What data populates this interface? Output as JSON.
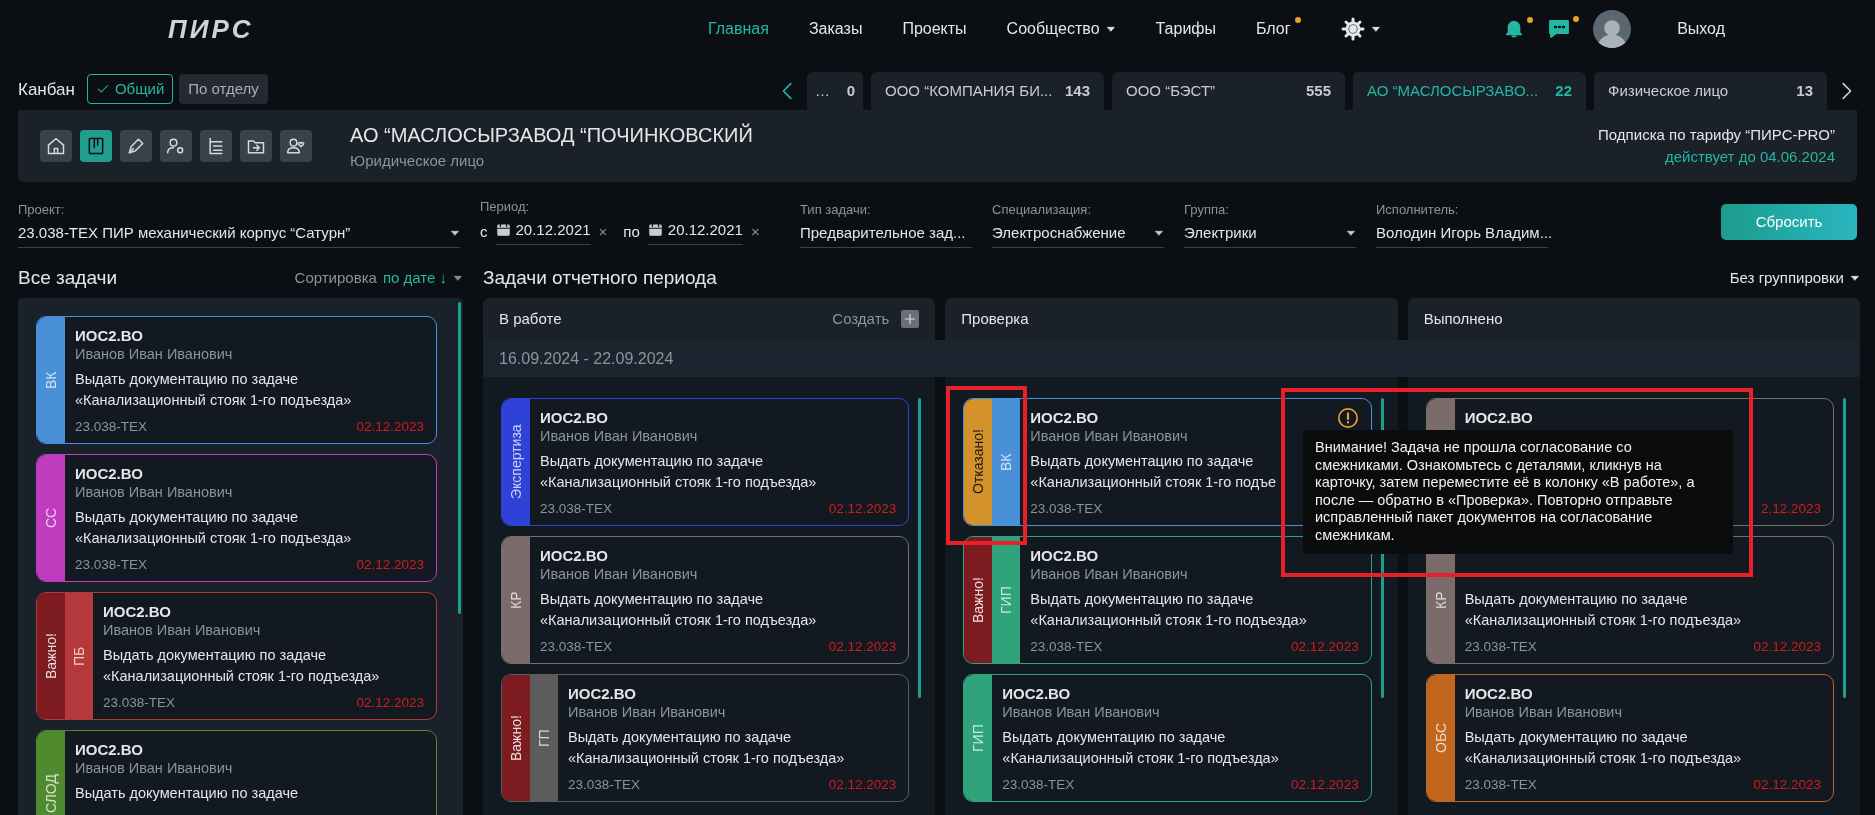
{
  "nav": {
    "logo": "ПИРС",
    "items": [
      {
        "label": "Главная",
        "selected": true,
        "dropdown": false,
        "dot": false
      },
      {
        "label": "Заказы",
        "selected": false,
        "dropdown": false,
        "dot": false
      },
      {
        "label": "Проекты",
        "selected": false,
        "dropdown": false,
        "dot": false
      },
      {
        "label": "Сообщество",
        "selected": false,
        "dropdown": true,
        "dot": false
      },
      {
        "label": "Тарифы",
        "selected": false,
        "dropdown": false,
        "dot": false
      },
      {
        "label": "Блог",
        "selected": false,
        "dropdown": false,
        "dot": true
      }
    ],
    "bell_dot": true,
    "chat_dot": true,
    "logout": "Выход"
  },
  "kanban": {
    "label": "Канбан",
    "scopes": [
      {
        "label": "Общий",
        "selected": true
      },
      {
        "label": "По отделу",
        "selected": false
      }
    ]
  },
  "client_tabs": [
    {
      "name": "…",
      "count": "0",
      "selected": false
    },
    {
      "name": "ООО “КОМПАНИЯ БИ...",
      "count": "143",
      "selected": false
    },
    {
      "name": "ООО “БЭСТ”",
      "count": "555",
      "selected": false
    },
    {
      "name": "АО “МАСЛОСЫРЗАВО...",
      "count": "22",
      "selected": true
    },
    {
      "name": "Физическое лицо",
      "count": "13",
      "selected": false
    }
  ],
  "toolbar": [
    {
      "kind": "home",
      "selected": false
    },
    {
      "kind": "board",
      "selected": true
    },
    {
      "kind": "pen",
      "selected": false
    },
    {
      "kind": "user-gear",
      "selected": false
    },
    {
      "kind": "tree",
      "selected": false
    },
    {
      "kind": "folder",
      "selected": false
    },
    {
      "kind": "user-heart",
      "selected": false
    }
  ],
  "client": {
    "title": "АО “МАСЛОСЫРЗАВОД “ПОЧИНКОВСКИЙ",
    "subtitle": "Юридическое лицо",
    "subscription": "Подписка по тарифу “ПИРС-PRO”",
    "valid_until": "действует до 04.06.2024"
  },
  "filters": [
    {
      "kind": "select",
      "label": "Проект:",
      "value": "23.038-ТЕХ ПИР механический корпус “Сатурн”"
    },
    {
      "kind": "period",
      "label": "Период:",
      "from": {
        "prefix": "с",
        "date": "20.12.2021",
        "clear": "×"
      },
      "to": {
        "prefix": "по",
        "date": "20.12.2021",
        "clear": "×"
      }
    },
    {
      "kind": "select",
      "label": "Тип задачи:",
      "value": "Предварительное зад..."
    },
    {
      "kind": "select",
      "label": "Специализация:",
      "value": "Электроснабжение"
    },
    {
      "kind": "select",
      "label": "Группа:",
      "value": "Электрики"
    },
    {
      "kind": "select",
      "label": "Исполнитель:",
      "value": "Володин Игорь Владим..."
    }
  ],
  "reset_button": "Сбросить",
  "all_tasks": {
    "title": "Все задачи",
    "sort_label": "Сортировка",
    "sort_value": "по дате ↓",
    "cards": [
      {
        "tag": "ВК",
        "color": "#4a90d9",
        "code": "ИОС2.ВО",
        "assignee": "Иванов Иван Иванович",
        "description": [
          "Выдать документацию по задаче",
          "«Канализационный стояк 1-го подъезда»"
        ],
        "project": "23.038-ТЕХ",
        "due": "02.12.2023"
      },
      {
        "tag": "СС",
        "color": "#c03cbf",
        "code": "ИОС2.ВО",
        "assignee": "Иванов Иван Иванович",
        "description": [
          "Выдать документацию по задаче",
          "«Канализационный стояк 1-го подъезда»"
        ],
        "project": "23.038-ТЕХ",
        "due": "02.12.2023"
      },
      {
        "tag": "ПБ",
        "color": "#b5393a",
        "flag": {
          "kind": "important",
          "label": "Важно!"
        },
        "code": "ИОС2.ВО",
        "assignee": "Иванов Иван Иванович",
        "description": [
          "Выдать документацию по задаче",
          "«Канализационный стояк 1-го подъезда»"
        ],
        "project": "23.038-ТЕХ",
        "due": "02.12.2023"
      },
      {
        "tag": "СЛОД",
        "color": "#4f8a2f",
        "code": "ИОС2.ВО",
        "assignee": "Иванов Иван Иванович",
        "description": [
          "Выдать документацию по задаче"
        ]
      }
    ]
  },
  "board": {
    "title": "Задачи отчетного периода",
    "grouping": "Без группировки",
    "period": "16.09.2024 - 22.09.2024",
    "columns": [
      {
        "title": "В работе",
        "create": "Создать",
        "cards": [
          {
            "tag": "Экспертиза",
            "color": "#2f42d8",
            "code": "ИОС2.ВО",
            "assignee": "Иванов Иван Иванович",
            "description": [
              "Выдать документацию по задаче",
              "«Канализационный стояк 1-го подъезда»"
            ],
            "project": "23.038-ТЕХ",
            "due": "02.12.2023"
          },
          {
            "tag": "КР",
            "color": "#7b6c6b",
            "code": "ИОС2.ВО",
            "assignee": "Иванов Иван Иванович",
            "description": [
              "Выдать документацию по задаче",
              "«Канализационный стояк 1-го подъезда»"
            ],
            "project": "23.038-ТЕХ",
            "due": "02.12.2023"
          },
          {
            "tag": "ГП",
            "color": "#5c5c5c",
            "flag": {
              "kind": "important",
              "label": "Важно!"
            },
            "code": "ИОС2.ВО",
            "assignee": "Иванов Иван Иванович",
            "description": [
              "Выдать документацию по задаче",
              "«Канализационный стояк 1-го подъезда»"
            ],
            "project": "23.038-ТЕХ",
            "due": "02.12.2023"
          }
        ]
      },
      {
        "title": "Проверка",
        "cards": [
          {
            "tag": "ВК",
            "color": "#4a90d9",
            "flag": {
              "kind": "refused",
              "label": "Отказано!"
            },
            "warning": true,
            "code": "ИОС2.ВО",
            "assignee": "Иванов Иван Иванович",
            "description": [
              "Выдать документацию по задаче",
              "«Канализационный стояк 1-го подъе"
            ],
            "project": "23.038-ТЕХ"
          },
          {
            "tag": "ГИП",
            "color": "#2fa37b",
            "flag": {
              "kind": "important",
              "label": "Важно!"
            },
            "code": "ИОС2.ВО",
            "assignee": "Иванов Иван Иванович",
            "description": [
              "Выдать документацию по задаче",
              "«Канализационный стояк 1-го подъезда»"
            ],
            "project": "23.038-ТЕХ",
            "due": "02.12.2023"
          },
          {
            "tag": "ГИП",
            "color": "#2fa37b",
            "code": "ИОС2.ВО",
            "assignee": "Иванов Иван Иванович",
            "description": [
              "Выдать документацию по задаче",
              "«Канализационный стояк 1-го подъезда»"
            ],
            "project": "23.038-ТЕХ",
            "due": "02.12.2023"
          }
        ]
      },
      {
        "title": "Выполнено",
        "cards": [
          {
            "color": "#7b6c6b",
            "code": "ИОС2.ВО",
            "due": "2.12.2023"
          },
          {
            "tag": "КР",
            "color": "#7b6c6b",
            "description": [
              "Выдать документацию по задаче",
              "«Канализационный стояк 1-го подъезда»"
            ],
            "project": "23.038-ТЕХ",
            "due": "02.12.2023"
          },
          {
            "tag": "ОБС",
            "color": "#c0661f",
            "code": "ИОС2.ВО",
            "assignee": "Иванов Иван Иванович",
            "description": [
              "Выдать документацию по задаче",
              "«Канализационный стояк 1-го подъезда»"
            ],
            "project": "23.038-ТЕХ",
            "due": "02.12.2023"
          }
        ]
      }
    ],
    "tooltip": "Внимание! Задача не прошла согласование со смежниками. Ознакомьтесь с деталями, кликнув на карточку, затем переместите её в колонку «В работе», а после — обратно в «Проверка». Повторно отправьте исправленный пакет документов на согласование смежникам."
  }
}
